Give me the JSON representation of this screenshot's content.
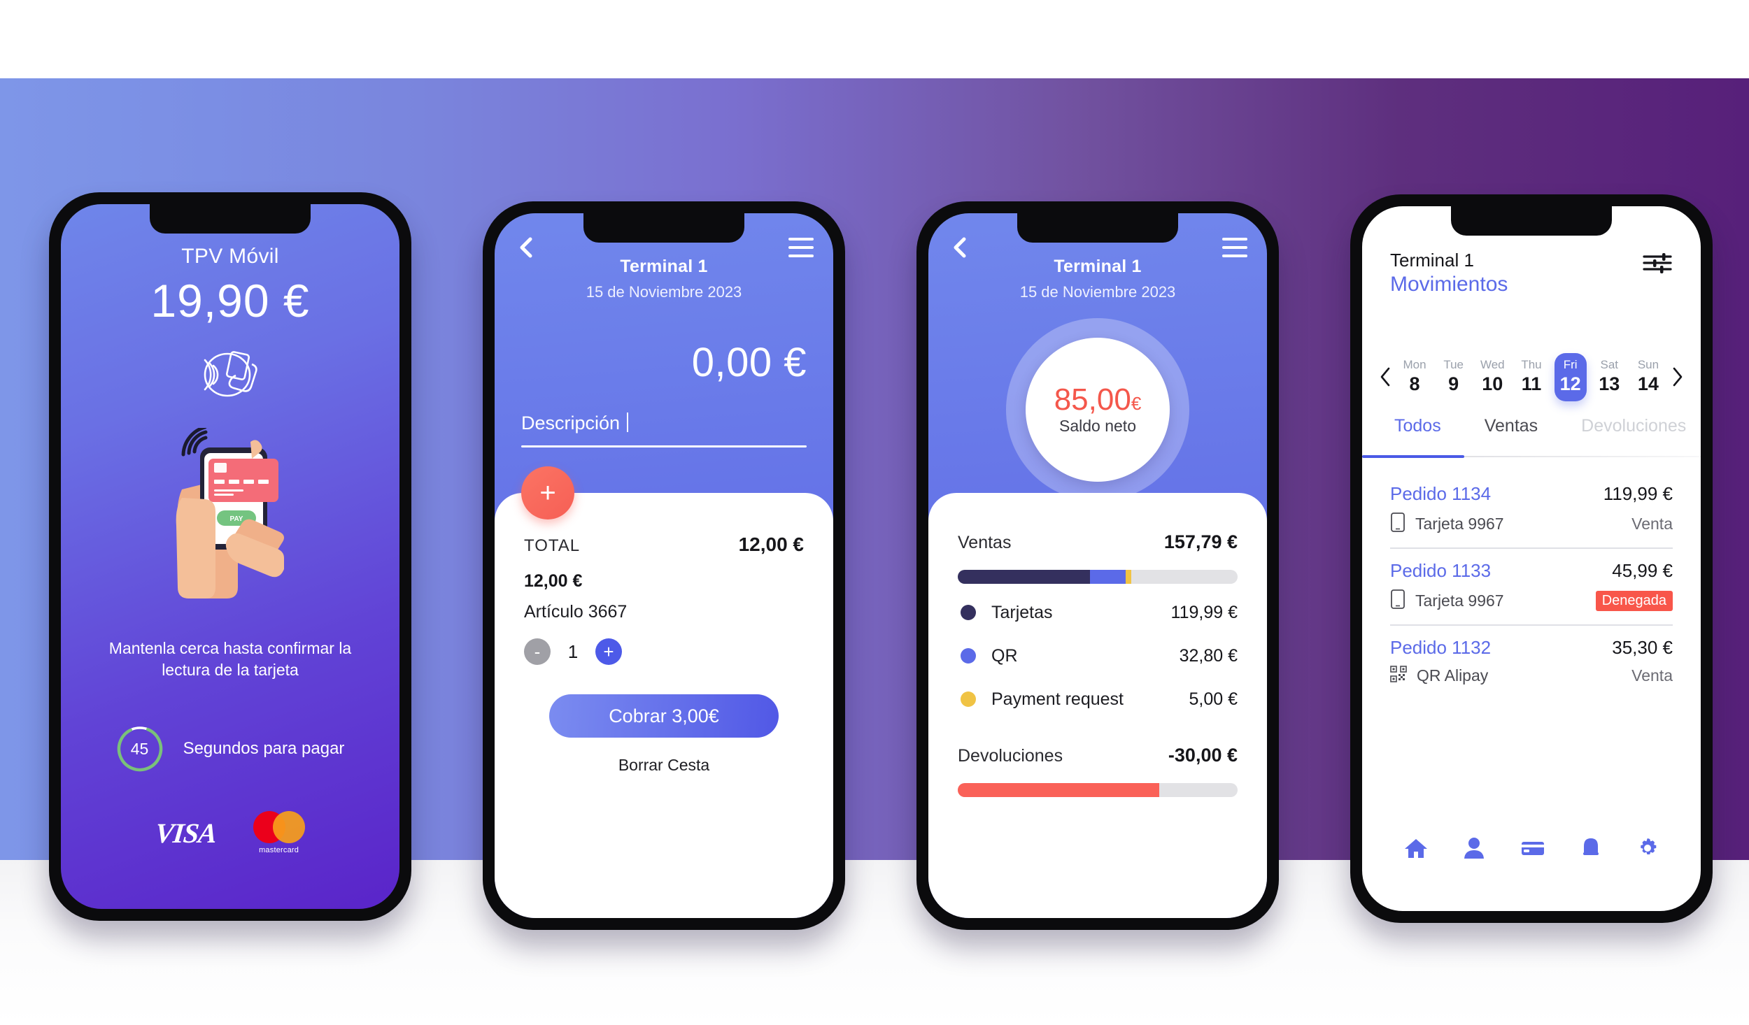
{
  "background": {
    "gradient_from": "#7e96e8",
    "gradient_to": "#57207a"
  },
  "phone1": {
    "title": "TPV Móvil",
    "amount": "19,90 €",
    "nfc_icon": "contactless-icon",
    "illustration": "hand-holding-phone-with-card-illustration",
    "pay_button_label": "PAY",
    "hint": "Mantenla cerca hasta confirmar la lectura de la tarjeta",
    "timer_seconds": "45",
    "timer_label": "Segundos para pagar",
    "brands": {
      "visa": "VISA",
      "mastercard": "mastercard"
    }
  },
  "phone2": {
    "back_icon": "chevron-left-icon",
    "menu_icon": "hamburger-menu-icon",
    "title": "Terminal 1",
    "date": "15 de Noviembre 2023",
    "amount": "0,00 €",
    "description_value": "Descripción",
    "description_placeholder": "Descripción",
    "add_button_label": "+",
    "total_label": "TOTAL",
    "total_value": "12,00 €",
    "line_price": "12,00 €",
    "line_name": "Artículo 3667",
    "stepper": {
      "minus": "-",
      "quantity": "1",
      "plus": "+"
    },
    "cta_label": "Cobrar 3,00€",
    "clear_label": "Borrar Cesta"
  },
  "phone3": {
    "back_icon": "chevron-left-icon",
    "menu_icon": "hamburger-menu-icon",
    "title": "Terminal 1",
    "date": "15 de Noviembre 2023",
    "balance_amount": "85,00",
    "balance_currency": "€",
    "balance_label": "Saldo neto",
    "sales_label": "Ventas",
    "sales_value": "157,79 €",
    "refunds_label": "Devoluciones",
    "refunds_value": "-30,00 €",
    "chart_data": {
      "type": "bar",
      "title": "Ventas",
      "categories": [
        "Tarjetas",
        "QR",
        "Payment request"
      ],
      "values": [
        119.99,
        32.8,
        5.0
      ],
      "colors": [
        "#34305e",
        "#5b6ae8",
        "#f0c344"
      ],
      "total": 157.79,
      "bar_track_color": "#e2e2e5",
      "filled_fraction": 0.62,
      "refunds": {
        "label": "Devoluciones",
        "value": -30.0,
        "color": "#fa6158",
        "filled_fraction": 0.72
      },
      "xlabel": "",
      "ylabel": "",
      "legend": "below-bar"
    },
    "legend": [
      {
        "name": "Tarjetas",
        "value": "119,99 €",
        "color": "#34305e"
      },
      {
        "name": "QR",
        "value": "32,80 €",
        "color": "#5b6ae8"
      },
      {
        "name": "Payment request",
        "value": "5,00 €",
        "color": "#f0c344"
      }
    ]
  },
  "phone4": {
    "terminal": "Terminal 1",
    "section": "Movimientos",
    "filter_icon": "sliders-filter-icon",
    "prev_icon": "chevron-left-icon",
    "next_icon": "chevron-right-icon",
    "dates": [
      {
        "dow": "Mon",
        "day": "8",
        "active": false
      },
      {
        "dow": "Tue",
        "day": "9",
        "active": false
      },
      {
        "dow": "Wed",
        "day": "10",
        "active": false
      },
      {
        "dow": "Thu",
        "day": "11",
        "active": false
      },
      {
        "dow": "Fri",
        "day": "12",
        "active": true
      },
      {
        "dow": "Sat",
        "day": "13",
        "active": false
      },
      {
        "dow": "Sun",
        "day": "14",
        "active": false
      }
    ],
    "tabs": [
      {
        "label": "Todos",
        "active": true
      },
      {
        "label": "Ventas",
        "active": false
      },
      {
        "label": "Devoluciones",
        "active": false
      }
    ],
    "transactions": [
      {
        "order": "Pedido 1134",
        "amount": "119,99 €",
        "method": "Tarjeta 9967",
        "method_icon": "mobile-phone-icon",
        "status": "Venta",
        "denied": false
      },
      {
        "order": "Pedido 1133",
        "amount": "45,99 €",
        "method": "Tarjeta 9967",
        "method_icon": "mobile-phone-icon",
        "status": "Denegada",
        "denied": true
      },
      {
        "order": "Pedido 1132",
        "amount": "35,30 €",
        "method": "QR Alipay",
        "method_icon": "qr-code-icon",
        "status": "Venta",
        "denied": false
      }
    ],
    "nav": [
      {
        "icon": "home-icon"
      },
      {
        "icon": "person-icon"
      },
      {
        "icon": "card-icon"
      },
      {
        "icon": "bell-icon"
      },
      {
        "icon": "gear-icon"
      }
    ],
    "accent": "#5b6ae8",
    "denied_color": "#f8564a"
  }
}
